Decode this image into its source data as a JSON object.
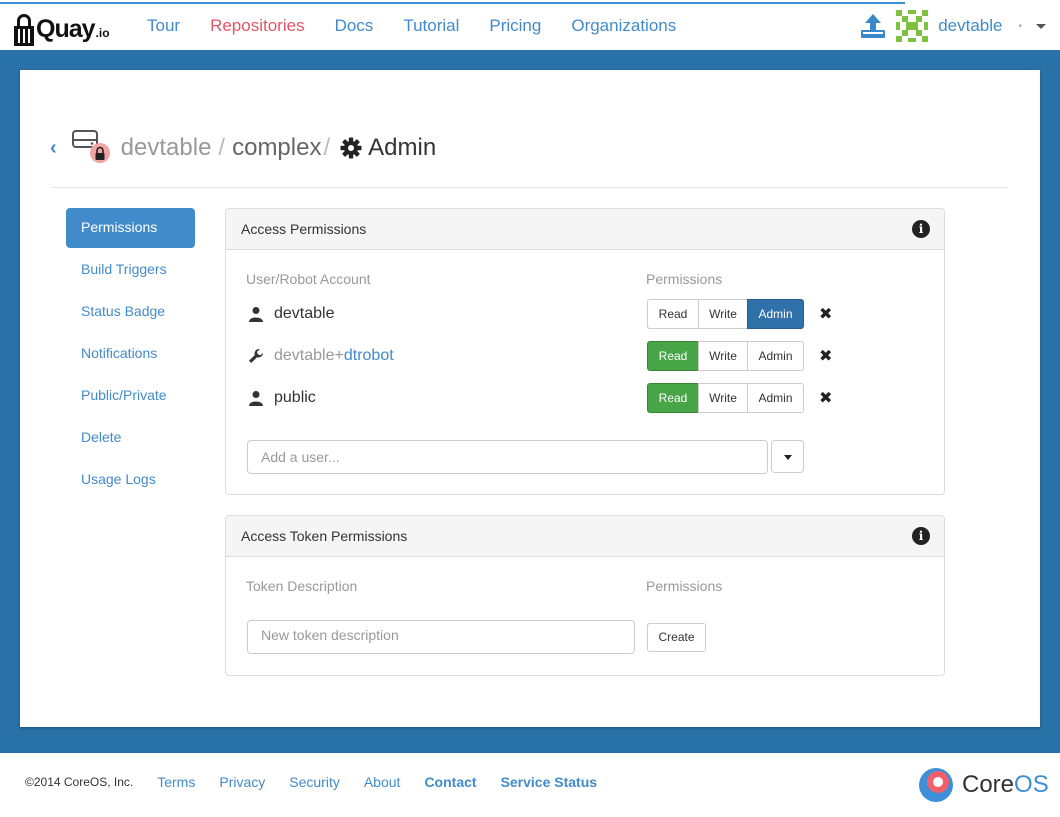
{
  "nav": {
    "logo_text": "Quay",
    "logo_sub": ".io",
    "links": [
      "Tour",
      "Repositories",
      "Docs",
      "Tutorial",
      "Pricing",
      "Organizations"
    ],
    "active_link": "Repositories",
    "user": "devtable",
    "dot": "•"
  },
  "header": {
    "namespace": "devtable",
    "sep": "/",
    "repository": "complex",
    "title": "Admin"
  },
  "sidebar": {
    "items": [
      "Permissions",
      "Build Triggers",
      "Status Badge",
      "Notifications",
      "Public/Private",
      "Delete",
      "Usage Logs"
    ],
    "active": "Permissions"
  },
  "access_permissions": {
    "title": "Access Permissions",
    "col_account": "User/Robot Account",
    "col_permissions": "Permissions",
    "buttons": {
      "read": "Read",
      "write": "Write",
      "admin": "Admin"
    },
    "rows": [
      {
        "type": "user",
        "name": "devtable",
        "role": "admin"
      },
      {
        "type": "robot",
        "namespace": "devtable+",
        "shortname": "dtrobot",
        "role": "read"
      },
      {
        "type": "user",
        "name": "public",
        "role": "read"
      }
    ],
    "remove_glyph": "✖",
    "add_placeholder": "Add a user..."
  },
  "token_permissions": {
    "title": "Access Token Permissions",
    "col_description": "Token Description",
    "col_permissions": "Permissions",
    "placeholder": "New token description",
    "create_label": "Create"
  },
  "footer": {
    "copyright": "©2014 CoreOS, Inc.",
    "links": [
      "Terms",
      "Privacy",
      "Security",
      "About"
    ],
    "bold_links": [
      "Contact",
      "Service Status"
    ],
    "brand_core": "Core",
    "brand_os": "OS"
  },
  "colors": {
    "brand_blue": "#2872a8",
    "link": "#428bca",
    "active_nav": "#e05667",
    "admin_on": "#3071a9",
    "read_on": "#47a447"
  }
}
